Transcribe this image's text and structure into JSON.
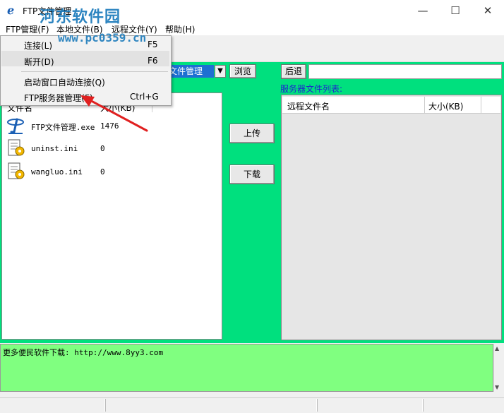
{
  "window": {
    "title": "FTP文件管理",
    "minimize": "—",
    "maximize": "☐",
    "close": "✕"
  },
  "watermark": {
    "line1": "河东软件园",
    "line2": "www.pc0359.cn"
  },
  "menubar": {
    "items": [
      "FTP管理(F)",
      "本地文件(B)",
      "远程文件(Y)",
      "帮助(H)"
    ]
  },
  "dropdown": {
    "items": [
      {
        "label": "连接(L)",
        "shortcut": "F5"
      },
      {
        "label": "断开(D)",
        "shortcut": "F6"
      },
      {
        "label": "启动窗口自动连接(Q)",
        "shortcut": ""
      },
      {
        "label": "FTP服务器管理(F)",
        "shortcut": "Ctrl+G"
      }
    ]
  },
  "local": {
    "path_select": "文件管理",
    "browse_button": "浏览",
    "columns": [
      "文件名",
      "大小(KB)"
    ],
    "files": [
      {
        "name": "FTP文件管理.exe",
        "size": "1476",
        "icon": "ftp-app-icon"
      },
      {
        "name": "uninst.ini",
        "size": "0",
        "icon": "ini-file-icon"
      },
      {
        "name": "wangluo.ini",
        "size": "0",
        "icon": "ini-file-icon"
      }
    ]
  },
  "transfer": {
    "upload": "上传",
    "download": "下载"
  },
  "remote": {
    "back_button": "后退",
    "path_value": "",
    "list_label": "服务器文件列表:",
    "columns": [
      "远程文件名",
      "大小(KB)"
    ]
  },
  "log": {
    "text": "更多便民软件下载: http://www.8yy3.com"
  },
  "colors": {
    "accent_green": "#00e07e",
    "log_green": "#80ff80",
    "select_blue": "#1e6fd2",
    "annotation_arrow": "#e02020"
  }
}
